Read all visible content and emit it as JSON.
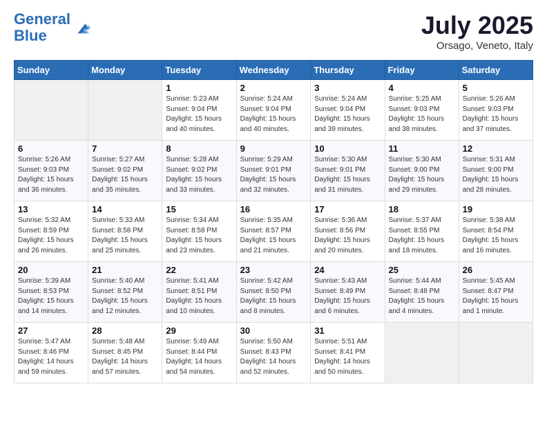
{
  "header": {
    "logo_general": "General",
    "logo_blue": "Blue",
    "month_title": "July 2025",
    "location": "Orsago, Veneto, Italy"
  },
  "days_of_week": [
    "Sunday",
    "Monday",
    "Tuesday",
    "Wednesday",
    "Thursday",
    "Friday",
    "Saturday"
  ],
  "weeks": [
    [
      {
        "day": "",
        "sunrise": "",
        "sunset": "",
        "daylight": ""
      },
      {
        "day": "",
        "sunrise": "",
        "sunset": "",
        "daylight": ""
      },
      {
        "day": "1",
        "sunrise": "Sunrise: 5:23 AM",
        "sunset": "Sunset: 9:04 PM",
        "daylight": "Daylight: 15 hours and 40 minutes."
      },
      {
        "day": "2",
        "sunrise": "Sunrise: 5:24 AM",
        "sunset": "Sunset: 9:04 PM",
        "daylight": "Daylight: 15 hours and 40 minutes."
      },
      {
        "day": "3",
        "sunrise": "Sunrise: 5:24 AM",
        "sunset": "Sunset: 9:04 PM",
        "daylight": "Daylight: 15 hours and 39 minutes."
      },
      {
        "day": "4",
        "sunrise": "Sunrise: 5:25 AM",
        "sunset": "Sunset: 9:03 PM",
        "daylight": "Daylight: 15 hours and 38 minutes."
      },
      {
        "day": "5",
        "sunrise": "Sunrise: 5:26 AM",
        "sunset": "Sunset: 9:03 PM",
        "daylight": "Daylight: 15 hours and 37 minutes."
      }
    ],
    [
      {
        "day": "6",
        "sunrise": "Sunrise: 5:26 AM",
        "sunset": "Sunset: 9:03 PM",
        "daylight": "Daylight: 15 hours and 36 minutes."
      },
      {
        "day": "7",
        "sunrise": "Sunrise: 5:27 AM",
        "sunset": "Sunset: 9:02 PM",
        "daylight": "Daylight: 15 hours and 35 minutes."
      },
      {
        "day": "8",
        "sunrise": "Sunrise: 5:28 AM",
        "sunset": "Sunset: 9:02 PM",
        "daylight": "Daylight: 15 hours and 33 minutes."
      },
      {
        "day": "9",
        "sunrise": "Sunrise: 5:29 AM",
        "sunset": "Sunset: 9:01 PM",
        "daylight": "Daylight: 15 hours and 32 minutes."
      },
      {
        "day": "10",
        "sunrise": "Sunrise: 5:30 AM",
        "sunset": "Sunset: 9:01 PM",
        "daylight": "Daylight: 15 hours and 31 minutes."
      },
      {
        "day": "11",
        "sunrise": "Sunrise: 5:30 AM",
        "sunset": "Sunset: 9:00 PM",
        "daylight": "Daylight: 15 hours and 29 minutes."
      },
      {
        "day": "12",
        "sunrise": "Sunrise: 5:31 AM",
        "sunset": "Sunset: 9:00 PM",
        "daylight": "Daylight: 15 hours and 28 minutes."
      }
    ],
    [
      {
        "day": "13",
        "sunrise": "Sunrise: 5:32 AM",
        "sunset": "Sunset: 8:59 PM",
        "daylight": "Daylight: 15 hours and 26 minutes."
      },
      {
        "day": "14",
        "sunrise": "Sunrise: 5:33 AM",
        "sunset": "Sunset: 8:58 PM",
        "daylight": "Daylight: 15 hours and 25 minutes."
      },
      {
        "day": "15",
        "sunrise": "Sunrise: 5:34 AM",
        "sunset": "Sunset: 8:58 PM",
        "daylight": "Daylight: 15 hours and 23 minutes."
      },
      {
        "day": "16",
        "sunrise": "Sunrise: 5:35 AM",
        "sunset": "Sunset: 8:57 PM",
        "daylight": "Daylight: 15 hours and 21 minutes."
      },
      {
        "day": "17",
        "sunrise": "Sunrise: 5:36 AM",
        "sunset": "Sunset: 8:56 PM",
        "daylight": "Daylight: 15 hours and 20 minutes."
      },
      {
        "day": "18",
        "sunrise": "Sunrise: 5:37 AM",
        "sunset": "Sunset: 8:55 PM",
        "daylight": "Daylight: 15 hours and 18 minutes."
      },
      {
        "day": "19",
        "sunrise": "Sunrise: 5:38 AM",
        "sunset": "Sunset: 8:54 PM",
        "daylight": "Daylight: 15 hours and 16 minutes."
      }
    ],
    [
      {
        "day": "20",
        "sunrise": "Sunrise: 5:39 AM",
        "sunset": "Sunset: 8:53 PM",
        "daylight": "Daylight: 15 hours and 14 minutes."
      },
      {
        "day": "21",
        "sunrise": "Sunrise: 5:40 AM",
        "sunset": "Sunset: 8:52 PM",
        "daylight": "Daylight: 15 hours and 12 minutes."
      },
      {
        "day": "22",
        "sunrise": "Sunrise: 5:41 AM",
        "sunset": "Sunset: 8:51 PM",
        "daylight": "Daylight: 15 hours and 10 minutes."
      },
      {
        "day": "23",
        "sunrise": "Sunrise: 5:42 AM",
        "sunset": "Sunset: 8:50 PM",
        "daylight": "Daylight: 15 hours and 8 minutes."
      },
      {
        "day": "24",
        "sunrise": "Sunrise: 5:43 AM",
        "sunset": "Sunset: 8:49 PM",
        "daylight": "Daylight: 15 hours and 6 minutes."
      },
      {
        "day": "25",
        "sunrise": "Sunrise: 5:44 AM",
        "sunset": "Sunset: 8:48 PM",
        "daylight": "Daylight: 15 hours and 4 minutes."
      },
      {
        "day": "26",
        "sunrise": "Sunrise: 5:45 AM",
        "sunset": "Sunset: 8:47 PM",
        "daylight": "Daylight: 15 hours and 1 minute."
      }
    ],
    [
      {
        "day": "27",
        "sunrise": "Sunrise: 5:47 AM",
        "sunset": "Sunset: 8:46 PM",
        "daylight": "Daylight: 14 hours and 59 minutes."
      },
      {
        "day": "28",
        "sunrise": "Sunrise: 5:48 AM",
        "sunset": "Sunset: 8:45 PM",
        "daylight": "Daylight: 14 hours and 57 minutes."
      },
      {
        "day": "29",
        "sunrise": "Sunrise: 5:49 AM",
        "sunset": "Sunset: 8:44 PM",
        "daylight": "Daylight: 14 hours and 54 minutes."
      },
      {
        "day": "30",
        "sunrise": "Sunrise: 5:50 AM",
        "sunset": "Sunset: 8:43 PM",
        "daylight": "Daylight: 14 hours and 52 minutes."
      },
      {
        "day": "31",
        "sunrise": "Sunrise: 5:51 AM",
        "sunset": "Sunset: 8:41 PM",
        "daylight": "Daylight: 14 hours and 50 minutes."
      },
      {
        "day": "",
        "sunrise": "",
        "sunset": "",
        "daylight": ""
      },
      {
        "day": "",
        "sunrise": "",
        "sunset": "",
        "daylight": ""
      }
    ]
  ]
}
